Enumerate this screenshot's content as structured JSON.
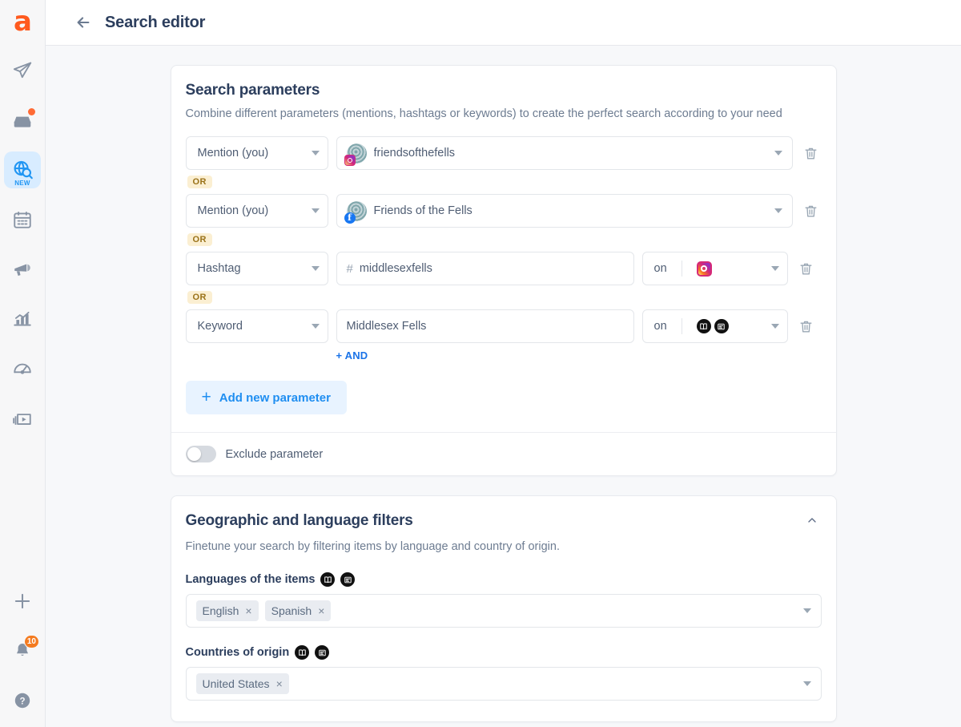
{
  "sidebar": {
    "logo": "a",
    "items": [
      {
        "name": "publish",
        "icon": "paper-plane-icon",
        "label": "Publish",
        "badge": null,
        "active": false
      },
      {
        "name": "inbox",
        "icon": "inbox-icon",
        "label": "Inbox",
        "badge": "dot",
        "active": false
      },
      {
        "name": "listening",
        "icon": "globe-search-icon",
        "label": "Listening",
        "tag": "NEW",
        "active": true
      },
      {
        "name": "calendar",
        "icon": "calendar-icon",
        "label": "Calendar",
        "badge": null,
        "active": false
      },
      {
        "name": "ads",
        "icon": "megaphone-icon",
        "label": "Ads",
        "badge": null,
        "active": false
      },
      {
        "name": "analytics",
        "icon": "bar-chart-icon",
        "label": "Analytics",
        "badge": null,
        "active": false
      },
      {
        "name": "benchmark",
        "icon": "speedometer-icon",
        "label": "Benchmark",
        "badge": null,
        "active": false
      },
      {
        "name": "media-library",
        "icon": "video-library-icon",
        "label": "Media library",
        "badge": null,
        "active": false
      }
    ],
    "bottom_items": [
      {
        "name": "add",
        "icon": "plus-icon",
        "label": "Add"
      },
      {
        "name": "notifications",
        "icon": "bell-icon",
        "label": "Notifications",
        "badge_count": "10"
      },
      {
        "name": "help",
        "icon": "question-mark-icon",
        "label": "Help"
      }
    ]
  },
  "header": {
    "back_label": "←",
    "title": "Search editor"
  },
  "search_parameters": {
    "title": "Search parameters",
    "description": "Combine different parameters (mentions, hashtags or keywords) to create the perfect search according to your need",
    "or_label": "OR",
    "and_label": "+ AND",
    "add_parameter_label": "Add new parameter",
    "add_parameter_plus": "+",
    "exclude_toggle_label": "Exclude parameter",
    "exclude_toggle_on": false,
    "rows": [
      {
        "type": "Mention (you)",
        "value": "friendsofthefells",
        "value_kind": "avatar",
        "network": "instagram",
        "has_on_field": false
      },
      {
        "type": "Mention (you)",
        "value": "Friends of the Fells",
        "value_kind": "avatar",
        "network": "facebook",
        "has_on_field": false
      },
      {
        "type": "Hashtag",
        "value": "middlesexfells",
        "value_kind": "hashtag",
        "hash_prefix": "#",
        "has_on_field": true,
        "on_label": "on",
        "on_icons": [
          "instagram-icon"
        ]
      },
      {
        "type": "Keyword",
        "value": "Middlesex Fells",
        "value_kind": "text",
        "has_on_field": true,
        "on_label": "on",
        "on_icons": [
          "news-icon",
          "blog-icon"
        ]
      }
    ]
  },
  "geo_filters": {
    "title": "Geographic and language filters",
    "description": "Finetune your search by filtering items by language and country of origin.",
    "collapse_icon": "chevron-up-icon",
    "languages_label": "Languages of the items",
    "languages_icons": [
      "news-icon",
      "blog-icon"
    ],
    "languages": [
      "English",
      "Spanish"
    ],
    "countries_label": "Countries of origin",
    "countries_icons": [
      "news-icon",
      "blog-icon"
    ],
    "countries": [
      "United States"
    ],
    "chip_remove": "×"
  },
  "colors": {
    "brand_orange": "#ff5a1f",
    "accent_blue": "#1f8ef1",
    "title_navy": "#2c3e5d",
    "or_badge_bg": "#fbefd2",
    "or_badge_text": "#9a7219",
    "badge_orange": "#f47b20"
  }
}
